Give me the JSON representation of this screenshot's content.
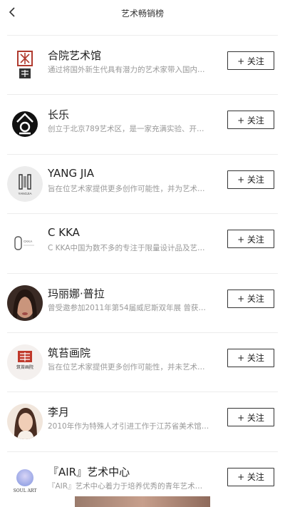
{
  "nav": {
    "title": "艺术畅销榜"
  },
  "follow_label": "+ 关注",
  "items": [
    {
      "name": "合院艺术馆",
      "desc": "通过将国外新生代具有潜力的艺术家带入国内…"
    },
    {
      "name": "长乐",
      "desc": "创立于北京789艺术区，是一家充满实验、开…"
    },
    {
      "name": "YANG JIA",
      "desc": "旨在位艺术家提供更多创作可能性，并为艺术…",
      "logo_text": "YANGJIA"
    },
    {
      "name": "C KKA",
      "desc": "C KKA中国为数不多的专注于限量设计品及艺…",
      "logo_text": "CKKA"
    },
    {
      "name": "玛丽娜·普拉",
      "desc": "曾受邀参加2011年第54届威尼斯双年展 曾获…"
    },
    {
      "name": "筑苔画院",
      "desc": "旨在位艺术家提供更多创作可能性，并未艺术…",
      "logo_text": "筑苔画院"
    },
    {
      "name": "李月",
      "desc": "2010年作为特殊人才引进工作于江苏省美术馆…"
    },
    {
      "name": "『AIR』艺术中心",
      "desc": "『AIR』艺术中心着力于培养优秀的青年艺术…",
      "logo_text": "SOUL ART"
    }
  ],
  "colors": {
    "divider": "#ececec",
    "text_primary": "#222222",
    "text_secondary": "#999999"
  }
}
